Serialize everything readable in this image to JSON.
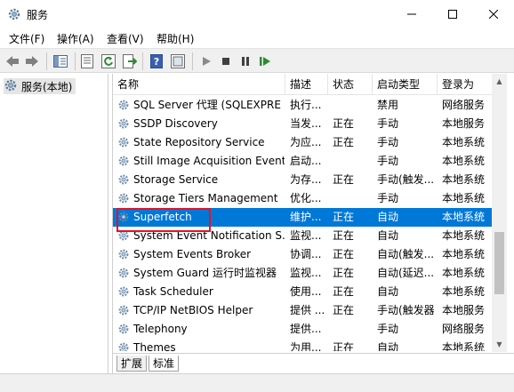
{
  "window": {
    "title": "服务",
    "controls": [
      "minimize",
      "maximize",
      "close"
    ]
  },
  "menu": {
    "items": [
      "文件(F)",
      "操作(A)",
      "查看(V)",
      "帮助(H)"
    ]
  },
  "toolbar": {
    "icons": [
      "back-icon",
      "forward-icon",
      "show-hide-tree-icon",
      "properties-icon",
      "refresh-icon",
      "export-icon",
      "help-icon",
      "view-icon",
      "start-icon",
      "stop-icon",
      "pause-icon",
      "restart-icon"
    ]
  },
  "tree": {
    "root_label": "服务(本地)"
  },
  "table": {
    "columns": [
      "名称",
      "描述",
      "状态",
      "启动类型",
      "登录为"
    ],
    "rows": [
      {
        "name": "SQL Server 代理 (SQLEXPRE",
        "desc": "执行...",
        "status": "",
        "startup": "禁用",
        "logon": "网络服务"
      },
      {
        "name": "SSDP Discovery",
        "desc": "当发...",
        "status": "正在",
        "startup": "手动",
        "logon": "本地服务"
      },
      {
        "name": "State Repository Service",
        "desc": "为应...",
        "status": "正在",
        "startup": "手动",
        "logon": "本地系统"
      },
      {
        "name": "Still Image Acquisition Events",
        "desc": "启动...",
        "status": "",
        "startup": "手动",
        "logon": "本地系统"
      },
      {
        "name": "Storage Service",
        "desc": "为存...",
        "status": "正在",
        "startup": "手动(触发...",
        "logon": "本地系统"
      },
      {
        "name": "Storage Tiers Management",
        "desc": "优化...",
        "status": "",
        "startup": "手动",
        "logon": "本地系统"
      },
      {
        "name": "Superfetch",
        "desc": "维护...",
        "status": "正在",
        "startup": "自动",
        "logon": "本地系统",
        "selected": true
      },
      {
        "name": "System Event Notification S...",
        "desc": "监视...",
        "status": "正在",
        "startup": "自动",
        "logon": "本地系统"
      },
      {
        "name": "System Events Broker",
        "desc": "协调...",
        "status": "正在",
        "startup": "自动(触发...",
        "logon": "本地系统"
      },
      {
        "name": "System Guard 运行时监视器",
        "desc": "监视...",
        "status": "正在",
        "startup": "自动(延迟...",
        "logon": "本地系统"
      },
      {
        "name": "Task Scheduler",
        "desc": "使用...",
        "status": "正在",
        "startup": "自动",
        "logon": "本地系统"
      },
      {
        "name": "TCP/IP NetBIOS Helper",
        "desc": "提供 ...",
        "status": "正在",
        "startup": "手动(触发器",
        "logon": "本地服务"
      },
      {
        "name": "Telephony",
        "desc": "提供...",
        "status": "",
        "startup": "手动",
        "logon": "网络服务"
      },
      {
        "name": "Themes",
        "desc": "为用...",
        "status": "正在",
        "startup": "自动",
        "logon": "本地系统"
      }
    ]
  },
  "tabs": {
    "items": [
      "扩展",
      "标准"
    ]
  },
  "colors": {
    "selection": "#0078d7",
    "highlight_border": "#e81123"
  }
}
